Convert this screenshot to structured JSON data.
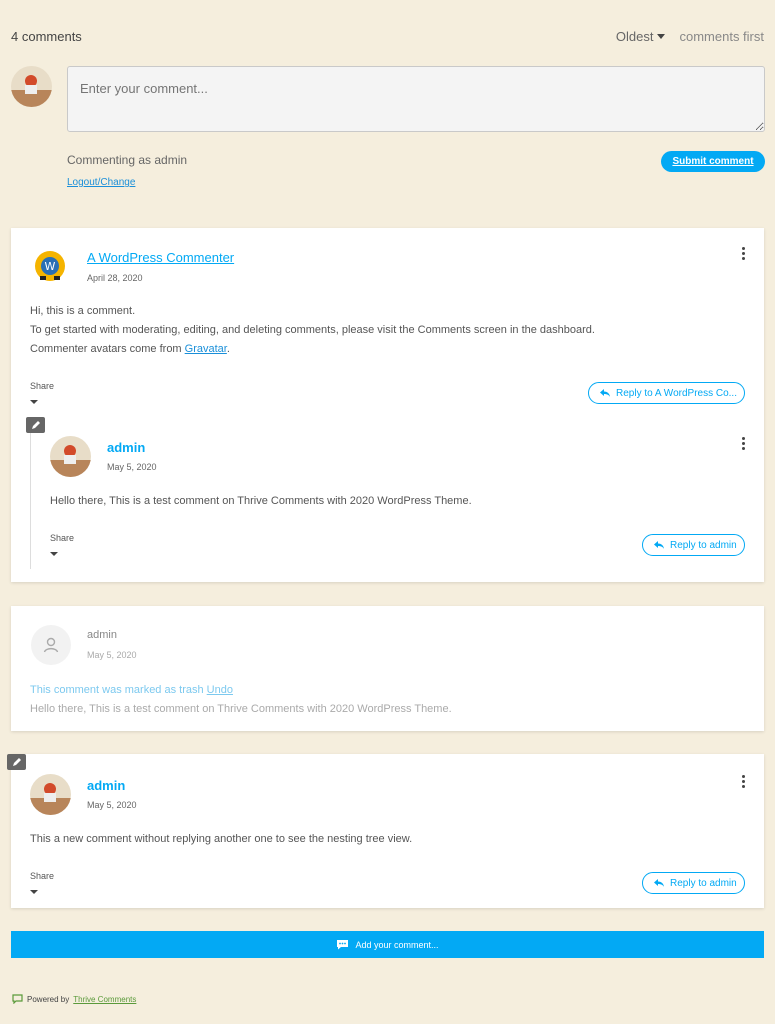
{
  "header": {
    "count_label": "4 comments",
    "sort_value": "Oldest",
    "sort_suffix": "comments first"
  },
  "composer": {
    "placeholder": "Enter your comment...",
    "commenting_as": "Commenting as admin",
    "logout_label": "Logout/Change",
    "submit_label": "Submit comment"
  },
  "comments": [
    {
      "author": "A WordPress Commenter",
      "date": "April 28, 2020",
      "lines": [
        "Hi, this is a comment.",
        "To get started with moderating, editing, and deleting comments, please visit the Comments screen in the dashboard.",
        "Commenter avatars come from "
      ],
      "link_text": "Gravatar",
      "after_link": ".",
      "share_label": "Share",
      "reply_label": "Reply to A WordPress Co..."
    },
    {
      "author": "admin",
      "date": "May 5, 2020",
      "text": "Hello there, This is a test comment on Thrive Comments with 2020 WordPress Theme.",
      "share_label": "Share",
      "reply_label": "Reply to admin"
    },
    {
      "author": "admin",
      "date": "May 5, 2020",
      "trash_note": "This comment was marked as trash ",
      "undo_label": "Undo",
      "text": "Hello there, This is a test comment on Thrive Comments with 2020 WordPress Theme."
    },
    {
      "author": "admin",
      "date": "May 5, 2020",
      "text": "This a new comment without replying another one to see the nesting tree view.",
      "share_label": "Share",
      "reply_label": "Reply to admin"
    }
  ],
  "footer": {
    "add_label": "Add your comment...",
    "powered_prefix": "Powered by ",
    "powered_link": "Thrive Comments"
  },
  "colors": {
    "background": "#f5eedd",
    "accent": "#03a9f4"
  },
  "icons": [
    "caret-down-icon",
    "kebab-menu-icon",
    "reply-arrow-icon",
    "pen-icon",
    "user-placeholder-icon",
    "chat-bubble-icon",
    "wordpress-avatar-icon"
  ]
}
